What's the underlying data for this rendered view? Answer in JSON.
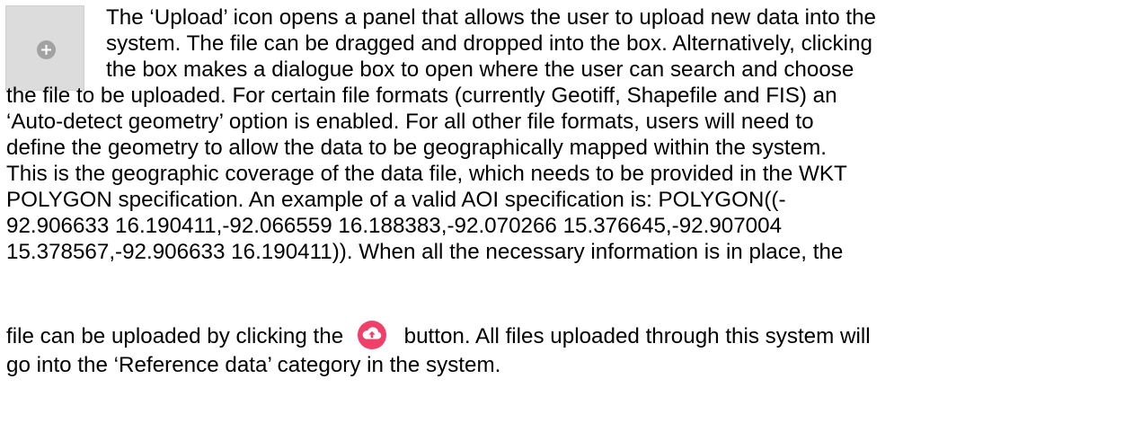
{
  "icon": {
    "name": "plus-circle-icon",
    "bg_color": "#dcdcdc",
    "glyph_color": "#a2a2a2"
  },
  "upload_button": {
    "name": "cloud-upload-icon",
    "color": "#f0406a"
  },
  "paragraph": {
    "line1": "The ‘Upload’ icon opens a panel that allows the user to upload new data into the",
    "line2": "system. The file can be dragged and dropped into the box. Alternatively, clicking",
    "line3": "the box makes a dialogue box to open where the user can search and choose",
    "line4": "the file to be uploaded. For certain file formats (currently Geotiff, Shapefile and FIS) an",
    "line5": "‘Auto-detect geometry’ option is enabled. For all other file formats, users will need to",
    "line6": "define the geometry to allow the data to be geographically mapped within the system.",
    "line7": "This is the geographic coverage of the data file, which needs to be provided in the WKT",
    "line8": "POLYGON specification. An example of a valid AOI specification is: POLYGON((-",
    "line9": "92.906633 16.190411,-92.066559 16.188383,-92.070266 15.376645,-92.907004",
    "line10": "15.378567,-92.906633 16.190411)). When all the necessary information is in place, the",
    "line11_before": "file can be uploaded by clicking the",
    "line11_after": "button. All files uploaded through this system will",
    "line12": "go into the ‘Reference data’ category in the system."
  }
}
